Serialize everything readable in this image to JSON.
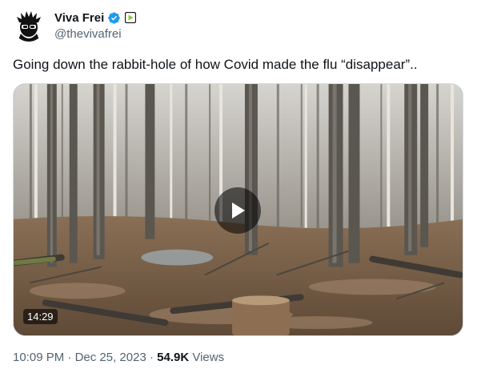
{
  "tweet": {
    "author": {
      "display_name": "Viva Frei",
      "handle": "@thevivafrei",
      "verified_icon": "verified-badge-icon",
      "affiliation_icon": "rumble-affiliate-icon",
      "avatar_icon": "avatar-icon"
    },
    "text": "Going down the rabbit-hole of how Covid made the flu “disappear”..",
    "media": {
      "duration": "14:29",
      "play_icon": "play-icon"
    },
    "meta": {
      "time": "10:09 PM",
      "separator": "·",
      "date": "Dec 25, 2023",
      "views_count": "54.9K",
      "views_label": "Views"
    }
  },
  "colors": {
    "verified_blue": "#1d9bf0",
    "secondary_text": "#536471",
    "primary_text": "#0f1419",
    "rumble_green": "#85c742"
  }
}
